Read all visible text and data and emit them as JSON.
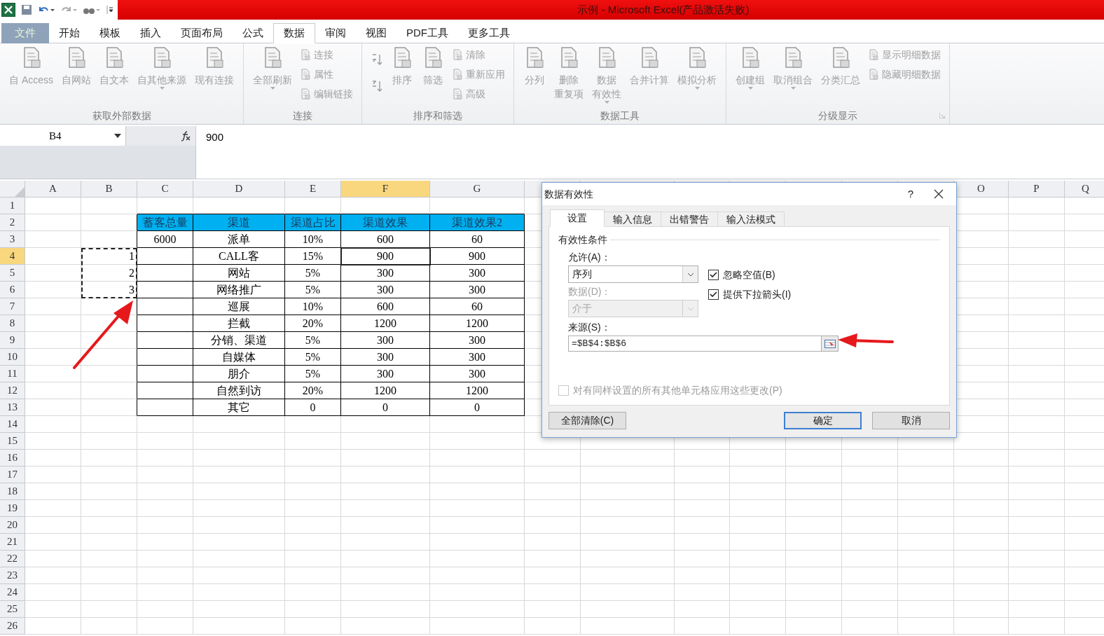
{
  "window": {
    "title": "示例 - Microsoft Excel(产品激活失败)"
  },
  "tabs": [
    {
      "label": "文件",
      "kind": "file",
      "selected": false
    },
    {
      "label": "开始",
      "kind": "tab",
      "selected": false
    },
    {
      "label": "模板",
      "kind": "tab",
      "selected": false
    },
    {
      "label": "插入",
      "kind": "tab",
      "selected": false
    },
    {
      "label": "页面布局",
      "kind": "tab",
      "selected": false
    },
    {
      "label": "公式",
      "kind": "tab",
      "selected": false
    },
    {
      "label": "数据",
      "kind": "tab",
      "selected": true
    },
    {
      "label": "审阅",
      "kind": "tab",
      "selected": false
    },
    {
      "label": "视图",
      "kind": "tab",
      "selected": false
    },
    {
      "label": "PDF工具",
      "kind": "tab",
      "selected": false
    },
    {
      "label": "更多工具",
      "kind": "tab",
      "selected": false
    }
  ],
  "ribbon": {
    "groups": [
      {
        "label": "获取外部数据",
        "items": [
          {
            "kind": "large",
            "lines": [
              "自 Access"
            ]
          },
          {
            "kind": "large",
            "lines": [
              "自网站"
            ]
          },
          {
            "kind": "large",
            "lines": [
              "自文本"
            ]
          },
          {
            "kind": "large",
            "lines": [
              "自其他来源"
            ],
            "has_menu": true
          },
          {
            "kind": "large",
            "lines": [
              "现有连接"
            ]
          }
        ]
      },
      {
        "label": "连接",
        "items": [
          {
            "kind": "large",
            "lines": [
              "全部刷新"
            ],
            "has_menu": true
          },
          {
            "kind": "small",
            "lines": [
              "连接"
            ]
          },
          {
            "kind": "small",
            "lines": [
              "属性"
            ]
          },
          {
            "kind": "small",
            "lines": [
              "编辑链接"
            ]
          }
        ]
      },
      {
        "label": "排序和筛选",
        "items": [
          {
            "kind": "sort"
          },
          {
            "kind": "large",
            "lines": [
              "排序"
            ]
          },
          {
            "kind": "large",
            "lines": [
              "筛选"
            ]
          },
          {
            "kind": "small",
            "lines": [
              "清除"
            ]
          },
          {
            "kind": "small",
            "lines": [
              "重新应用"
            ]
          },
          {
            "kind": "small",
            "lines": [
              "高级"
            ]
          }
        ]
      },
      {
        "label": "数据工具",
        "items": [
          {
            "kind": "large",
            "lines": [
              "分列"
            ]
          },
          {
            "kind": "large",
            "lines": [
              "删除",
              "重复项"
            ]
          },
          {
            "kind": "large",
            "lines": [
              "数据",
              "有效性"
            ],
            "has_menu": true
          },
          {
            "kind": "large",
            "lines": [
              "合并计算"
            ]
          },
          {
            "kind": "large",
            "lines": [
              "模拟分析"
            ],
            "has_menu": true
          }
        ]
      },
      {
        "label": "分级显示",
        "launcher": true,
        "items": [
          {
            "kind": "large",
            "lines": [
              "创建组"
            ],
            "has_menu": true
          },
          {
            "kind": "large",
            "lines": [
              "取消组合"
            ],
            "has_menu": true
          },
          {
            "kind": "large",
            "lines": [
              "分类汇总"
            ]
          },
          {
            "kind": "small",
            "lines": [
              "显示明细数据"
            ]
          },
          {
            "kind": "small",
            "lines": [
              "隐藏明细数据"
            ]
          }
        ]
      }
    ]
  },
  "formula_bar": {
    "name_box": "B4",
    "formula": "900"
  },
  "sheet": {
    "columns": [
      {
        "label": "A",
        "selected": false
      },
      {
        "label": "B",
        "selected": false
      },
      {
        "label": "C",
        "selected": false
      },
      {
        "label": "D",
        "selected": false
      },
      {
        "label": "E",
        "selected": false
      },
      {
        "label": "F",
        "selected": true
      },
      {
        "label": "G",
        "selected": false
      }
    ],
    "columns_right": [
      "O",
      "P",
      "Q"
    ],
    "rows": [
      {
        "label": "1",
        "selected": false
      },
      {
        "label": "2",
        "selected": false
      },
      {
        "label": "3",
        "selected": false
      },
      {
        "label": "4",
        "selected": true
      },
      {
        "label": "5",
        "selected": false
      },
      {
        "label": "6",
        "selected": false
      },
      {
        "label": "7",
        "selected": false
      },
      {
        "label": "8",
        "selected": false
      },
      {
        "label": "9",
        "selected": false
      },
      {
        "label": "10",
        "selected": false
      },
      {
        "label": "11",
        "selected": false
      },
      {
        "label": "12",
        "selected": false
      },
      {
        "label": "13",
        "selected": false
      },
      {
        "label": "14",
        "selected": false
      },
      {
        "label": "15",
        "selected": false
      },
      {
        "label": "16",
        "selected": false
      },
      {
        "label": "17",
        "selected": false
      },
      {
        "label": "18",
        "selected": false
      },
      {
        "label": "19",
        "selected": false
      },
      {
        "label": "20",
        "selected": false
      },
      {
        "label": "21",
        "selected": false
      },
      {
        "label": "22",
        "selected": false
      },
      {
        "label": "23",
        "selected": false
      },
      {
        "label": "24",
        "selected": false
      },
      {
        "label": "25",
        "selected": false
      },
      {
        "label": "26",
        "selected": false
      }
    ],
    "list_values": [
      "1",
      "2",
      "3"
    ],
    "table": {
      "header": [
        "蓄客总量",
        "渠道",
        "渠道占比",
        "渠道效果",
        "渠道效果2"
      ],
      "rows": [
        {
          "total": "6000",
          "channel": "派单",
          "share": "10%",
          "effect": "600",
          "effect_2": "60"
        },
        {
          "channel": "CALL客",
          "share": "15%",
          "effect": "900",
          "effect_2": "900"
        },
        {
          "channel": "网站",
          "share": "5%",
          "effect": "300",
          "effect_2": "300"
        },
        {
          "channel": "网络推广",
          "share": "5%",
          "effect": "300",
          "effect_2": "300"
        },
        {
          "channel": "巡展",
          "share": "10%",
          "effect": "600",
          "effect_2": "60"
        },
        {
          "channel": "拦截",
          "share": "20%",
          "effect": "1200",
          "effect_2": "1200"
        },
        {
          "channel": "分销、渠道",
          "share": "5%",
          "effect": "300",
          "effect_2": "300"
        },
        {
          "channel": "自媒体",
          "share": "5%",
          "effect": "300",
          "effect_2": "300"
        },
        {
          "channel": "朋介",
          "share": "5%",
          "effect": "300",
          "effect_2": "300"
        },
        {
          "channel": "自然到访",
          "share": "20%",
          "effect": "1200",
          "effect_2": "1200"
        },
        {
          "channel": "其它",
          "share": "0",
          "effect": "0",
          "effect_2": "0"
        }
      ]
    }
  },
  "dialog": {
    "title": "数据有效性",
    "help": "?",
    "tabs": [
      {
        "label": "设置",
        "selected": true
      },
      {
        "label": "输入信息",
        "selected": false
      },
      {
        "label": "出错警告",
        "selected": false
      },
      {
        "label": "输入法模式",
        "selected": false
      }
    ],
    "section": "有效性条件",
    "allow": {
      "label": "允许(A)：",
      "value": "序列",
      "disabled": false
    },
    "data": {
      "label": "数据(D)：",
      "value": "介于",
      "disabled": true
    },
    "checkboxes": [
      {
        "label": "忽略空值(B)",
        "checked": true
      },
      {
        "label": "提供下拉箭头(I)",
        "checked": true
      }
    ],
    "source": {
      "label": "来源(S)：",
      "value": "=$B$4:$B$6"
    },
    "apply_all": {
      "label": "对有同样设置的所有其他单元格应用这些更改(P)",
      "checked": false,
      "disabled": true
    },
    "buttons": [
      {
        "label": "全部清除(C)",
        "kind": "left"
      },
      {
        "label": "确定",
        "kind": "default"
      },
      {
        "label": "取消",
        "kind": "normal"
      }
    ]
  }
}
